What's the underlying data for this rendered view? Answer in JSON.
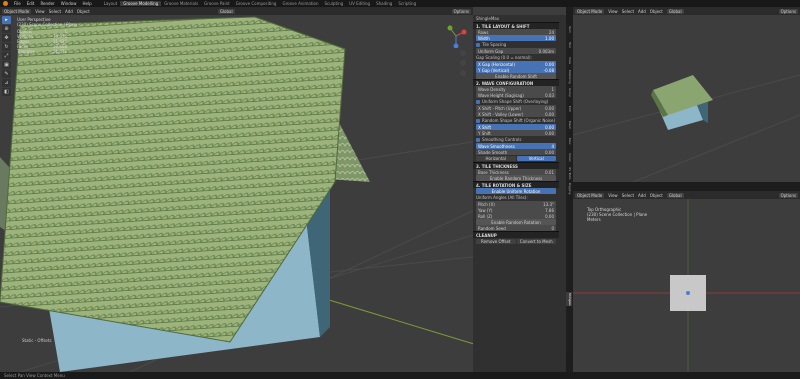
{
  "menubar": {
    "items": [
      "File",
      "Edit",
      "Render",
      "Window",
      "Help"
    ],
    "workspaces": [
      "Layout",
      "Groove Modelling",
      "Groove Materials",
      "Groove Paint",
      "Groove Compositing",
      "Groove Animation",
      "Sculpting",
      "UV Editing",
      "Shading",
      "Scripting"
    ],
    "active_workspace": "Groove Modelling"
  },
  "viewport": {
    "mode": "Object Mode",
    "menus": [
      "View",
      "Select",
      "Add",
      "Object"
    ],
    "orientation": "Global",
    "options": "Options",
    "header_title": "User Perspective",
    "collection": "(230) Scene Collection | Plane",
    "stats": [
      {
        "label": "Objects",
        "value": "1"
      },
      {
        "label": "Vertices",
        "value": "10,876"
      },
      {
        "label": "Edges",
        "value": "21,435"
      },
      {
        "label": "Faces",
        "value": "10,668"
      },
      {
        "label": "Triangles",
        "value": "21,576"
      }
    ],
    "tools": [
      "select-icon",
      "cursor-icon",
      "move-icon",
      "rotate-icon",
      "scale-icon",
      "transform-icon",
      "annotate-icon",
      "measure-icon",
      "add-cube-icon"
    ],
    "status": "Static - Offsets"
  },
  "npanel": {
    "title": "ShingleMax",
    "sections": [
      {
        "title": "1. TILE LAYOUT & SHIFT"
      },
      {
        "title": "2. WAVE CONFIGURATION"
      },
      {
        "title": "3. TILE THICKNESS"
      },
      {
        "title": "4. TILE ROTATION & SIZE"
      },
      {
        "title": "CLEANUP"
      }
    ],
    "layout": {
      "fields": [
        {
          "label": "Rows",
          "value": "24"
        },
        {
          "label": "Width",
          "value": "1.00"
        }
      ],
      "tile_spacing": "Tile Spacing",
      "uniform_gap": "Uniform Gap",
      "uniform_gap_value": "0.003m",
      "gap_scaling": "Gap Scaling (0.0 = normal):",
      "x_gap": "X Gap (Horizontal)",
      "x_gap_value": "0.00",
      "y_gap": "Y Gap (Vertical)",
      "y_gap_value": "-0.08",
      "enable_button": "Enable Random Shift"
    },
    "wave": {
      "fields": [
        {
          "label": "Wave Density",
          "value": "1"
        },
        {
          "label": "Wave Height (Sag/sag)",
          "value": "0.03"
        }
      ],
      "uniform_label": "Uniform Shape Shift (Overlaying)",
      "shift_fields": [
        {
          "label": "X Shift - Pitch (Upper)",
          "value": "0.00"
        },
        {
          "label": "X Shift - Valley (Lower)",
          "value": "0.00"
        }
      ],
      "random_label": "Random Shape Shift (Organic Noise)",
      "random_fields": [
        {
          "label": "X Shift",
          "value": "0.00"
        },
        {
          "label": "Y Shift",
          "value": "0.00"
        }
      ],
      "smooth_label": "Smoothing Controls",
      "smooth_fields": [
        {
          "label": "Wave Smoothness",
          "value": "4"
        },
        {
          "label": "Shade Smooth",
          "value": "0.00"
        }
      ],
      "axis_buttons": [
        "Horizontal",
        "Vertical"
      ]
    },
    "thickness": {
      "fields": [
        {
          "label": "Base Thickness",
          "value": "0.01"
        }
      ],
      "button": "Enable Random Thickness"
    },
    "rotation": {
      "button_top": "Enable Uniform Rotation",
      "uniform_label": "Uniform Angles (All Tiles):",
      "fields": [
        {
          "label": "Pitch (X)",
          "value": "13.3°"
        },
        {
          "label": "Yaw (Y)",
          "value": "7.86"
        },
        {
          "label": "Roll (Z)",
          "value": "0.00"
        }
      ],
      "enable_random": "Enable Random Rotation",
      "random_seed": "Random Seed",
      "seed_value": "0"
    },
    "cleanup": {
      "remove": "Remove Offset",
      "convert": "Convert to Mesh"
    },
    "vertical_tabs": [
      "Item",
      "Tool",
      "View",
      "Modeling",
      "Group",
      "Edit",
      "Mesh",
      "Misc",
      "Slices",
      "UV Tools",
      "Rigging",
      "Shingles"
    ],
    "active_tab": "Shingles"
  },
  "right_top": {
    "mode": "Object Mode",
    "menus": [
      "View",
      "Select",
      "Add",
      "Object"
    ],
    "orientation": "Global",
    "options": "Options"
  },
  "right_bottom": {
    "mode": "Object Mode",
    "menus": [
      "View",
      "Select",
      "Add",
      "Object"
    ],
    "orientation": "Global",
    "options": "Options",
    "header_title": "Top Orthographic",
    "collection": "(230) Scene Collection | Plane",
    "units": "Meters"
  },
  "statusbar": {
    "left": "Select   Pan View   Context Menu"
  },
  "colors": {
    "tile": "#9cb37c",
    "tile_dark": "#6f8a56",
    "wall": "#8db6c8",
    "accent": "#4772b3",
    "bg": "#3d3d3d"
  }
}
